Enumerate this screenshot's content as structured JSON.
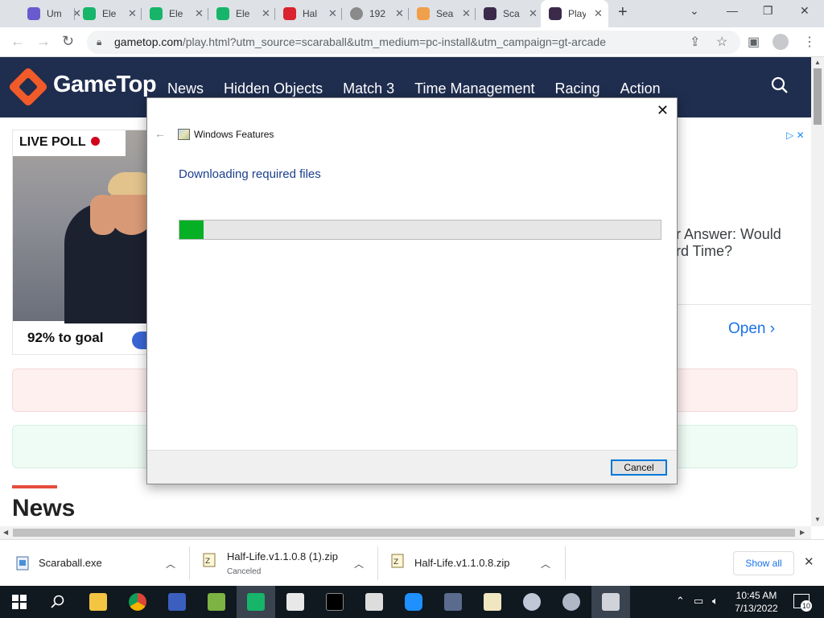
{
  "browser": {
    "tabs": [
      {
        "label": "Um",
        "color": "#6a5acd"
      },
      {
        "label": "Ele",
        "color": "#16b56a"
      },
      {
        "label": "Ele",
        "color": "#16b56a"
      },
      {
        "label": "Ele",
        "color": "#16b56a"
      },
      {
        "label": "Hal",
        "color": "#d9232e"
      },
      {
        "label": "192",
        "color": "#8a8a8a"
      },
      {
        "label": "Sea",
        "color": "#f0a04b"
      },
      {
        "label": "Sca",
        "color": "#3b2a4a"
      },
      {
        "label": "Play",
        "color": "#3b2a4a"
      }
    ],
    "url_host": "gametop.com",
    "url_rest": "/play.html?utm_source=scaraball&utm_medium=pc-install&utm_campaign=gt-arcade"
  },
  "site": {
    "logo": "GameTop",
    "nav": [
      "News",
      "Hidden Objects",
      "Match 3",
      "Time Management",
      "Racing",
      "Action"
    ],
    "poll_label": "LIVE POLL",
    "poll_goal": "92% to goal",
    "ad_text_line1": "r Answer: Would",
    "ad_text_line2": "rd Time?",
    "ad_open": "Open",
    "news_heading": "News"
  },
  "dialog": {
    "window_title": "Windows Features",
    "heading": "Downloading required files",
    "progress_percent": 5,
    "cancel_label": "Cancel",
    "close_glyph": "✕",
    "back_glyph": "←"
  },
  "downloads": {
    "items": [
      {
        "name": "Scaraball.exe",
        "status": ""
      },
      {
        "name": "Half-Life.v1.1.0.8 (1).zip",
        "status": "Canceled"
      },
      {
        "name": "Half-Life.v1.1.0.8.zip",
        "status": ""
      }
    ],
    "show_all": "Show all"
  },
  "taskbar": {
    "time": "10:45 AM",
    "date": "7/13/2022",
    "notification_count": "10"
  }
}
